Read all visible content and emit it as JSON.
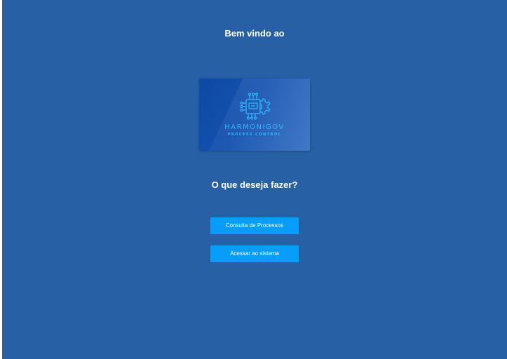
{
  "welcome_text": "Bem vindo ao",
  "logo": {
    "brand_name": "HARMONIGOV",
    "tagline": "PROCESS CONTROL",
    "icon": "chip-gear-icon"
  },
  "question": "O que deseja fazer?",
  "actions": {
    "consult_label": "Consulta de Processos",
    "access_label": "Acessar ao sistema"
  },
  "colors": {
    "background": "#2760a4",
    "button": "#079dfa",
    "logo_accent": "#21b6ff"
  }
}
